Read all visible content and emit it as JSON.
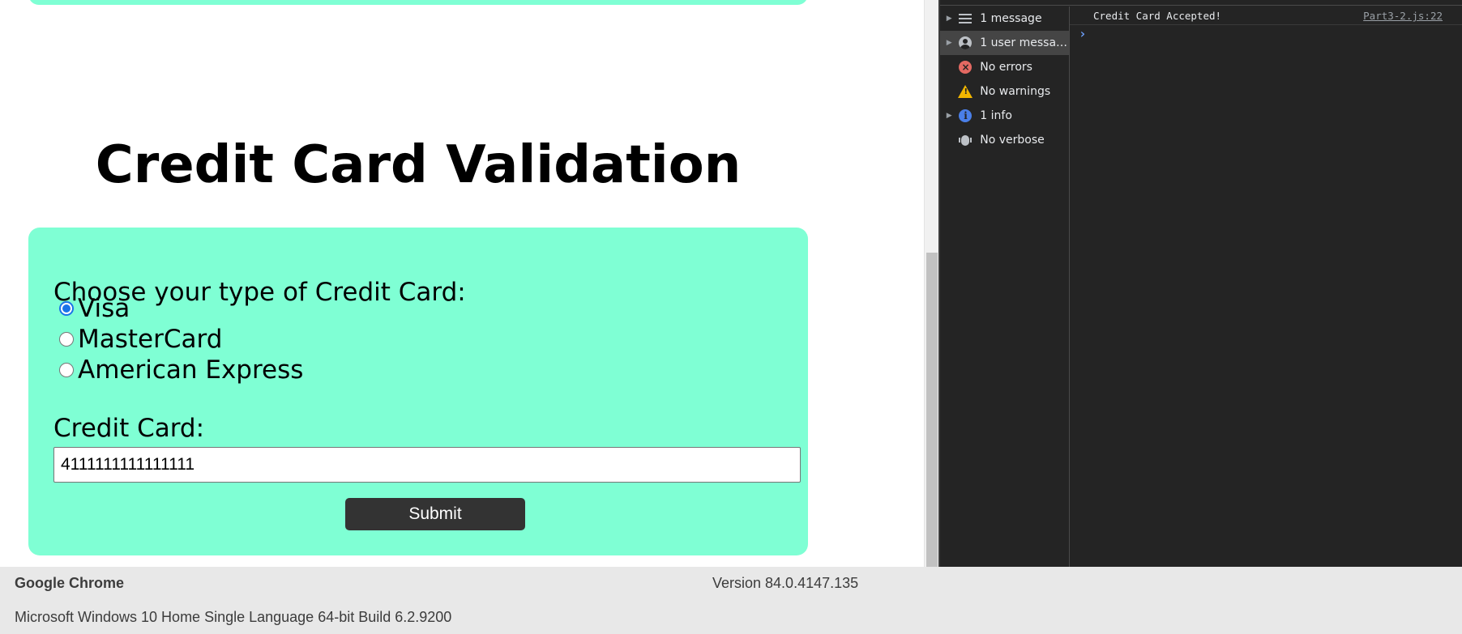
{
  "page": {
    "title": "Credit Card Validation",
    "choose_label": "Choose your type of Credit Card:",
    "card_types": [
      {
        "label": "Visa",
        "checked": true
      },
      {
        "label": "MasterCard",
        "checked": false
      },
      {
        "label": "American Express",
        "checked": false
      }
    ],
    "cc_label": "Credit Card:",
    "cc_value": "4111111111111111",
    "submit_label": "Submit",
    "panel_color": "#7fffd4"
  },
  "devtools": {
    "sidebar": [
      {
        "label": "1 message",
        "icon": "list-icon",
        "expandable": true
      },
      {
        "label": "1 user messages",
        "icon": "user-icon",
        "expandable": true,
        "selected": true
      },
      {
        "label": "No errors",
        "icon": "error-icon",
        "expandable": false
      },
      {
        "label": "No warnings",
        "icon": "warning-icon",
        "expandable": false
      },
      {
        "label": "1 info",
        "icon": "info-icon",
        "expandable": true
      },
      {
        "label": "No verbose",
        "icon": "bug-icon",
        "expandable": false
      }
    ],
    "log": {
      "message": "Credit Card Accepted!",
      "source": "Part3-2.js:22"
    }
  },
  "footer": {
    "browser_name": "Google Chrome",
    "version": "Version 84.0.4147.135",
    "os": "Microsoft Windows 10 Home Single Language 64-bit Build 6.2.9200"
  }
}
